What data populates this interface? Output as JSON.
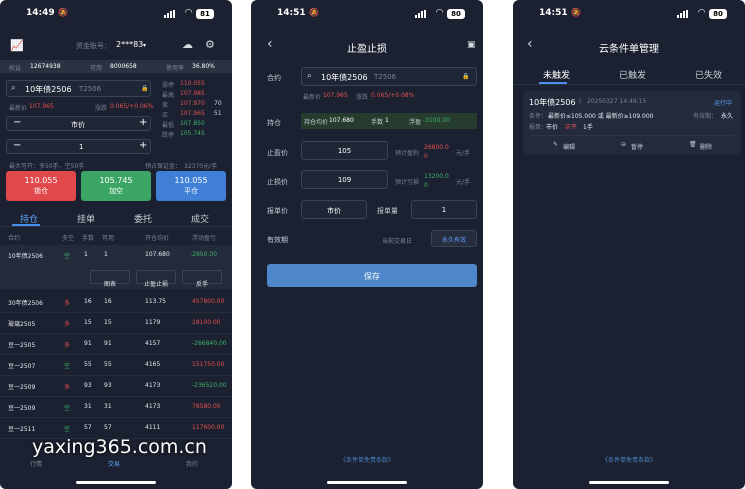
{
  "screen1": {
    "status": {
      "time": "14:49",
      "battery": "81"
    },
    "header": {
      "account_label": "资金账号：",
      "account_value": "2***83"
    },
    "summary": {
      "equity_label": "权益",
      "equity_value": "12674938",
      "available_label": "可用",
      "available_value": "8000658",
      "usage_label": "使用率",
      "usage_value": "36.80%"
    },
    "contract": {
      "name": "10年债2506",
      "code": "T2506",
      "last_label": "最新价",
      "last_value": "107.965",
      "change_label": "涨跌",
      "change_value": "0.065/+0.06%"
    },
    "order": {
      "price_mode": "市价",
      "quantity": "1",
      "max_label": "最大可开：多50手，空50手",
      "margin_label": "预占保证金：",
      "margin_value": "32370元/手"
    },
    "quote_panel": [
      {
        "label": "涨停",
        "value": "110.055",
        "extra": ""
      },
      {
        "label": "最高",
        "value": "107.985",
        "extra": ""
      },
      {
        "label": "卖",
        "value": "107.970",
        "extra": "70"
      },
      {
        "label": "买",
        "value": "107.965",
        "extra": "51"
      },
      {
        "label": "最低",
        "value": "107.850",
        "extra": ""
      },
      {
        "label": "跌停",
        "value": "105.745",
        "extra": ""
      }
    ],
    "action_buttons": [
      {
        "price": "110.055",
        "label": "锁仓",
        "color": "#e0484b"
      },
      {
        "price": "105.745",
        "label": "加空",
        "color": "#3aa565"
      },
      {
        "price": "110.055",
        "label": "平仓",
        "color": "#3f7fd6"
      }
    ],
    "tabs": [
      "持仓",
      "挂单",
      "委托",
      "成交"
    ],
    "table_headers": [
      "合约",
      "多空",
      "手数",
      "可用",
      "开仓均价",
      "浮动盈亏"
    ],
    "expanded_row": {
      "contract": "10年债2506",
      "direction": "空",
      "lots": "1",
      "available": "1",
      "price": "107.680",
      "pnl": "-2850.00"
    },
    "row_actions": [
      "图表",
      "止盈止损",
      "反手"
    ],
    "rows": [
      {
        "contract": "30年债2506",
        "direction": "多",
        "lots": "16",
        "available": "16",
        "price": "113.75",
        "pnl": "457800.00"
      },
      {
        "contract": "玻璃2505",
        "direction": "多",
        "lots": "15",
        "available": "15",
        "price": "1179",
        "pnl": "18100.00"
      },
      {
        "contract": "豆一2505",
        "direction": "多",
        "lots": "91",
        "available": "91",
        "price": "4157",
        "pnl": "-266840.00"
      },
      {
        "contract": "豆一2507",
        "direction": "空",
        "lots": "55",
        "available": "55",
        "price": "4165",
        "pnl": "151750.00"
      },
      {
        "contract": "豆一2509",
        "direction": "多",
        "lots": "93",
        "available": "93",
        "price": "4173",
        "pnl": "-236520.00"
      },
      {
        "contract": "豆一2509",
        "direction": "空",
        "lots": "31",
        "available": "31",
        "price": "4173",
        "pnl": "78580.00"
      },
      {
        "contract": "豆一2511",
        "direction": "空",
        "lots": "57",
        "available": "57",
        "price": "4111",
        "pnl": "117600.00"
      }
    ],
    "bottom_nav": [
      "行情",
      "交易",
      "我的"
    ],
    "watermark": "yaxing365.com.cn"
  },
  "screen2": {
    "status": {
      "time": "14:51",
      "battery": "80"
    },
    "title": "止盈止损",
    "contract": {
      "label": "合约",
      "name": "10年债2506",
      "code": "T2506",
      "last_label": "最新价",
      "last_value": "107.965",
      "change_label": "涨跌",
      "change_value": "0.065/+0.08%"
    },
    "position": {
      "label": "持仓",
      "avg_label": "持仓均价",
      "avg_value": "107.680",
      "lots_label": "手数",
      "lots_value": "1",
      "pnl_label": "浮盈",
      "pnl_value": "-3100.00"
    },
    "take_profit": {
      "label": "止盈价",
      "value": "105",
      "expected_label": "预计盈利",
      "expected_value": "26800.00",
      "unit": "元/手"
    },
    "stop_loss": {
      "label": "止损价",
      "value": "109",
      "expected_label": "预计亏损",
      "expected_value": "13200.00",
      "unit": "元/手"
    },
    "order_price": {
      "label": "报单价",
      "value": "市价",
      "qty_label": "报单量",
      "qty_value": "1"
    },
    "validity": {
      "label": "有效期",
      "option1": "当前交易日",
      "option2": "永久有效"
    },
    "save_label": "保存",
    "disclaimer": "《条件单免责条款》"
  },
  "screen3": {
    "status": {
      "time": "14:51",
      "battery": "80"
    },
    "title": "云条件单管理",
    "tabs": [
      "未触发",
      "已触发",
      "已失效"
    ],
    "card": {
      "contract": "10年债2506",
      "time": "20250327 14:49:15",
      "status": "运行中",
      "condition_label": "条件：",
      "condition_value": "最新价≤105.000 或 最新价≥109.000",
      "validity_label": "有效期：",
      "validity_value": "永久",
      "order_label": "报单：",
      "order_price": "市价",
      "order_action": "买平",
      "order_qty": "1手",
      "actions": [
        "编辑",
        "暂停",
        "删除"
      ]
    },
    "disclaimer": "《条件单免责条款》"
  }
}
